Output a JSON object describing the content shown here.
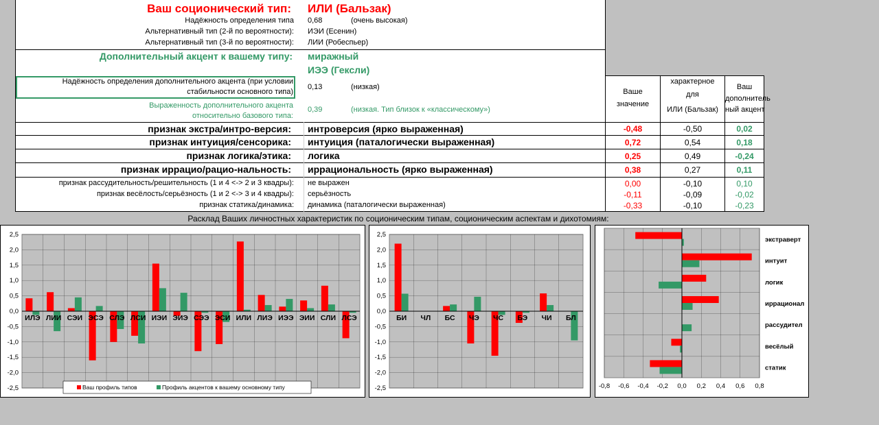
{
  "header": {
    "type_label": "Ваш соционический тип:",
    "type_value": "ИЛИ (Бальзак)",
    "reliability_label": "Надёжность определения типа",
    "reliability_value": "0,68",
    "reliability_note": "(очень высокая)",
    "alt2_label": "Альтернативный тип (2-й по вероятности):",
    "alt2_value": "ИЭИ (Есенин)",
    "alt3_label": "Альтернативный тип (3-й по вероятности):",
    "alt3_value": "ЛИИ (Робеспьер)",
    "accent_label": "Дополнительный акцент к вашему типу:",
    "accent_value1": "миражный",
    "accent_value2": "ИЭЭ (Гексли)",
    "accent_rel_label1": "Надёжность определения дополнительного акцента (при условии",
    "accent_rel_label2": "стабильности основного типа)",
    "accent_rel_value": "0,13",
    "accent_rel_note": "(низкая)",
    "expr_label1": "Выраженность дополнительного акцента",
    "expr_label2": "относительно базового типа:",
    "expr_value": "0,39",
    "expr_note": "(низкая. Тип близок к «классическому»)"
  },
  "columns": {
    "col1_line1": "Ваше",
    "col1_line2": "значение",
    "col2_line1": "характерное",
    "col2_line2": "для",
    "col2_line3": "ИЛИ (Бальзак)",
    "col3_line1": "Ваш",
    "col3_line2": "дополнитель",
    "col3_line3": "ный акцент"
  },
  "rows": [
    {
      "label": "признак экстра/интро-версия:",
      "value": "интроверсия (ярко выраженная)",
      "yours": "-0,48",
      "typical": "-0,50",
      "accent": "0,02"
    },
    {
      "label": "признак интуиция/сенсорика:",
      "value": "интуиция (паталогически выраженная)",
      "yours": "0,72",
      "typical": "0,54",
      "accent": "0,18"
    },
    {
      "label": "признак логика/этика:",
      "value": "логика",
      "yours": "0,25",
      "typical": "0,49",
      "accent": "-0,24"
    },
    {
      "label": "признак иррацио/рацио-нальность:",
      "value": "иррациональность (ярко выраженная)",
      "yours": "0,38",
      "typical": "0,27",
      "accent": "0,11"
    },
    {
      "label": "признак рассудительность/решительность (1 и 4 <-> 2 и 3 квадры):",
      "value": "не выражен",
      "yours": "0,00",
      "typical": "-0,10",
      "accent": "0,10"
    },
    {
      "label": "признак весёлость/серьёзность (1 и 2 <-> 3 и 4 квадры):",
      "value": "серьёзность",
      "yours": "-0,11",
      "typical": "-0,09",
      "accent": "-0,02"
    },
    {
      "label": "признак статика/динамика:",
      "value": "динамика (паталогически выраженная)",
      "yours": "-0,33",
      "typical": "-0,10",
      "accent": "-0,23"
    }
  ],
  "caption": "Расклад Ваших личностных характеристик по соционическим типам, соционическим аспектам и дихотомиям:",
  "colors": {
    "red": "#ff0000",
    "green": "#339966",
    "plot_bg": "#c0c0c0"
  },
  "chart_data": [
    {
      "type": "bar",
      "categories": [
        "ИЛЭ",
        "ЛИИ",
        "СЭИ",
        "ЭСЭ",
        "СЛЭ",
        "ЛСИ",
        "ИЭИ",
        "ЭИЭ",
        "СЭЭ",
        "ЭСИ",
        "ИЛИ",
        "ЛИЭ",
        "ИЭЭ",
        "ЭИИ",
        "СЛИ",
        "ЛСЭ"
      ],
      "series": [
        {
          "name": "Ваш профиль типов",
          "values": [
            0.42,
            0.62,
            0.1,
            -1.6,
            -1.0,
            -0.8,
            1.55,
            -0.15,
            -1.3,
            -1.07,
            2.27,
            0.53,
            0.15,
            0.35,
            0.83,
            -0.88
          ]
        },
        {
          "name": "Профиль акцентов к вашему основному типу",
          "values": [
            -0.12,
            -0.65,
            0.45,
            0.17,
            -0.58,
            -1.05,
            0.75,
            0.6,
            -0.05,
            -0.35,
            0.05,
            0.2,
            0.4,
            0.1,
            0.22,
            -0.05
          ]
        }
      ],
      "ylim": [
        -2.5,
        2.5
      ],
      "yticks": [
        "2,5",
        "2,0",
        "1,5",
        "1,0",
        "0,5",
        "0,0",
        "-0,5",
        "-1,0",
        "-1,5",
        "-2,0",
        "-2,5"
      ],
      "grid": true,
      "legend": "bottom"
    },
    {
      "type": "bar",
      "categories": [
        "БИ",
        "ЧЛ",
        "БС",
        "ЧЭ",
        "ЧС",
        "БЭ",
        "ЧИ",
        "БЛ"
      ],
      "series": [
        {
          "values": [
            2.2,
            0.0,
            0.17,
            -1.05,
            -1.45,
            -0.38,
            0.58,
            0.0
          ]
        },
        {
          "values": [
            0.57,
            0.0,
            0.22,
            0.47,
            -0.12,
            -0.05,
            0.2,
            -0.95
          ]
        }
      ],
      "ylim": [
        -2.5,
        2.5
      ],
      "yticks": [
        "2,5",
        "2,0",
        "1,5",
        "1,0",
        "0,5",
        "0,0",
        "-0,5",
        "-1,0",
        "-1,5",
        "-2,0",
        "-2,5"
      ],
      "grid": true
    },
    {
      "type": "bar",
      "orientation": "horizontal",
      "categories": [
        "экстраверт",
        "интуит",
        "логик",
        "иррационал",
        "рассудител",
        "весёлый",
        "статик"
      ],
      "series": [
        {
          "values": [
            -0.48,
            0.72,
            0.25,
            0.38,
            0.0,
            -0.11,
            -0.33
          ]
        },
        {
          "values": [
            0.02,
            0.18,
            -0.24,
            0.11,
            0.1,
            -0.02,
            -0.23
          ]
        }
      ],
      "xlim": [
        -0.8,
        0.8
      ],
      "xticks": [
        "-0,8",
        "-0,6",
        "-0,4",
        "-0,2",
        "0,0",
        "0,2",
        "0,4",
        "0,6",
        "0,8"
      ],
      "grid": true
    }
  ]
}
